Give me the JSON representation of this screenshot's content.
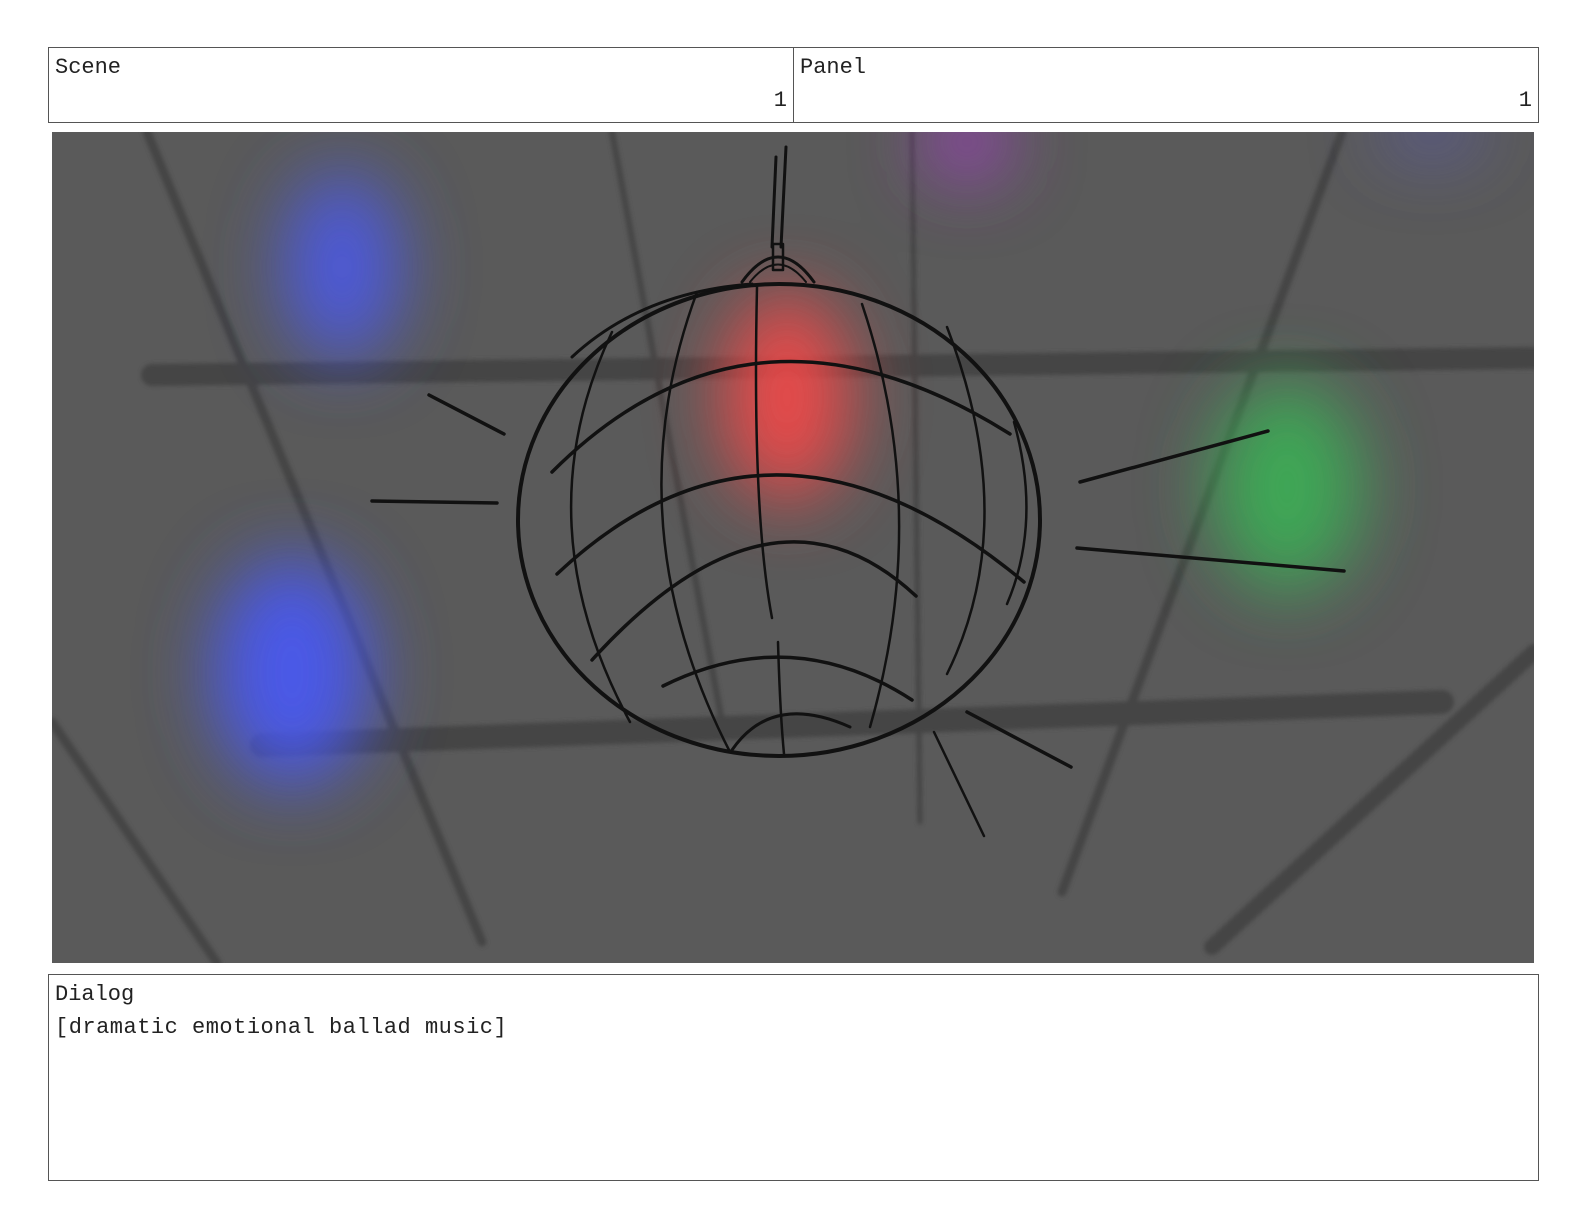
{
  "header": {
    "scene_label": "Scene",
    "scene_number": "1",
    "panel_label": "Panel",
    "panel_number": "1"
  },
  "panel_image": {
    "icon": "disco-ball-sketch",
    "background_color": "#5a5a5a",
    "light_colors": [
      "#4a5af0",
      "#f04848",
      "#3ab055",
      "#a040c0"
    ]
  },
  "dialog": {
    "label": "Dialog",
    "text": "[dramatic emotional ballad music]"
  }
}
